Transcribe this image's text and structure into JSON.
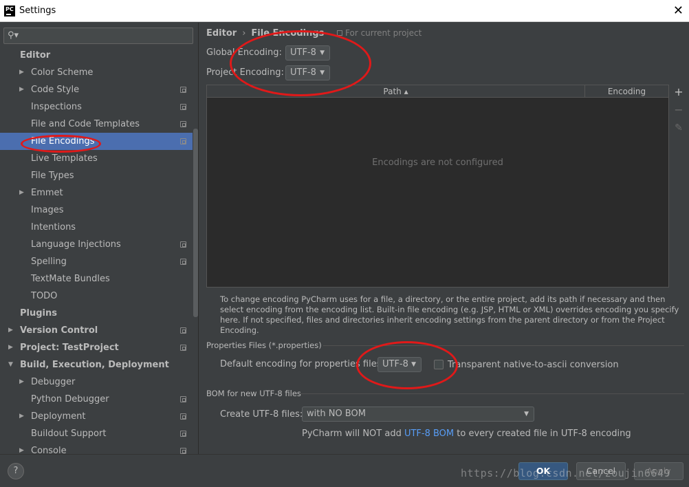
{
  "window": {
    "app_icon_text": "PC",
    "title": "Settings"
  },
  "search": {
    "value": ""
  },
  "sidebar": {
    "items": [
      {
        "label": "Editor",
        "bold": true,
        "arrow": "",
        "project": false
      },
      {
        "label": "Color Scheme",
        "bold": false,
        "arrow": "▶",
        "project": false
      },
      {
        "label": "Code Style",
        "bold": false,
        "arrow": "▶",
        "project": true
      },
      {
        "label": "Inspections",
        "bold": false,
        "arrow": "",
        "project": true
      },
      {
        "label": "File and Code Templates",
        "bold": false,
        "arrow": "",
        "project": true
      },
      {
        "label": "File Encodings",
        "bold": false,
        "arrow": "",
        "project": true,
        "selected": true
      },
      {
        "label": "Live Templates",
        "bold": false,
        "arrow": "",
        "project": false
      },
      {
        "label": "File Types",
        "bold": false,
        "arrow": "",
        "project": false
      },
      {
        "label": "Emmet",
        "bold": false,
        "arrow": "▶",
        "project": false
      },
      {
        "label": "Images",
        "bold": false,
        "arrow": "",
        "project": false
      },
      {
        "label": "Intentions",
        "bold": false,
        "arrow": "",
        "project": false
      },
      {
        "label": "Language Injections",
        "bold": false,
        "arrow": "",
        "project": true
      },
      {
        "label": "Spelling",
        "bold": false,
        "arrow": "",
        "project": true
      },
      {
        "label": "TextMate Bundles",
        "bold": false,
        "arrow": "",
        "project": false
      },
      {
        "label": "TODO",
        "bold": false,
        "arrow": "",
        "project": false
      },
      {
        "label": "Plugins",
        "bold": true,
        "arrow": "",
        "project": false
      },
      {
        "label": "Version Control",
        "bold": true,
        "arrow": "▶",
        "project": true
      },
      {
        "label": "Project: TestProject",
        "bold": true,
        "arrow": "▶",
        "project": true
      },
      {
        "label": "Build, Execution, Deployment",
        "bold": true,
        "arrow": "▼",
        "project": false
      },
      {
        "label": "Debugger",
        "bold": false,
        "arrow": "▶",
        "project": false
      },
      {
        "label": "Python Debugger",
        "bold": false,
        "arrow": "",
        "project": true
      },
      {
        "label": "Deployment",
        "bold": false,
        "arrow": "▶",
        "project": true
      },
      {
        "label": "Buildout Support",
        "bold": false,
        "arrow": "",
        "project": true
      },
      {
        "label": "Console",
        "bold": false,
        "arrow": "▶",
        "project": true
      }
    ]
  },
  "breadcrumb": {
    "parent": "Editor",
    "separator": "›",
    "current": "File Encodings",
    "scope": "For current project"
  },
  "global_encoding": {
    "label": "Global Encoding:",
    "value": "UTF-8"
  },
  "project_encoding": {
    "label": "Project Encoding:",
    "value": "UTF-8"
  },
  "table": {
    "columns": [
      "Path ▴",
      "Encoding"
    ],
    "empty_text": "Encodings are not configured",
    "tools": {
      "add": "+",
      "remove": "−",
      "edit": "✎"
    }
  },
  "help_text": "To change encoding PyCharm uses for a file, a directory, or the entire project, add its path if necessary and then select encoding from the encoding list. Built-in file encoding (e.g. JSP, HTML or XML) overrides encoding you specify here. If not specified, files and directories inherit encoding settings from the parent directory or from the Project Encoding.",
  "properties": {
    "section_title": "Properties Files (*.properties)",
    "default_label": "Default encoding for properties files:",
    "default_value": "UTF-8",
    "transparent_label": "Transparent native-to-ascii conversion",
    "transparent_checked": false
  },
  "bom": {
    "section_title": "BOM for new UTF-8 files",
    "create_label": "Create UTF-8 files:",
    "create_value": "with NO BOM",
    "note_prefix": "PyCharm will NOT add ",
    "note_link": "UTF-8 BOM",
    "note_suffix": " to every created file in UTF-8 encoding"
  },
  "footer": {
    "help": "?",
    "ok": "OK",
    "cancel": "Cancel",
    "apply": "Apply",
    "watermark": "https://blog.csdn.net/zoujin6649"
  },
  "colors": {
    "accent": "#4b6eaf",
    "annotation": "#e01919",
    "link": "#589df6"
  }
}
